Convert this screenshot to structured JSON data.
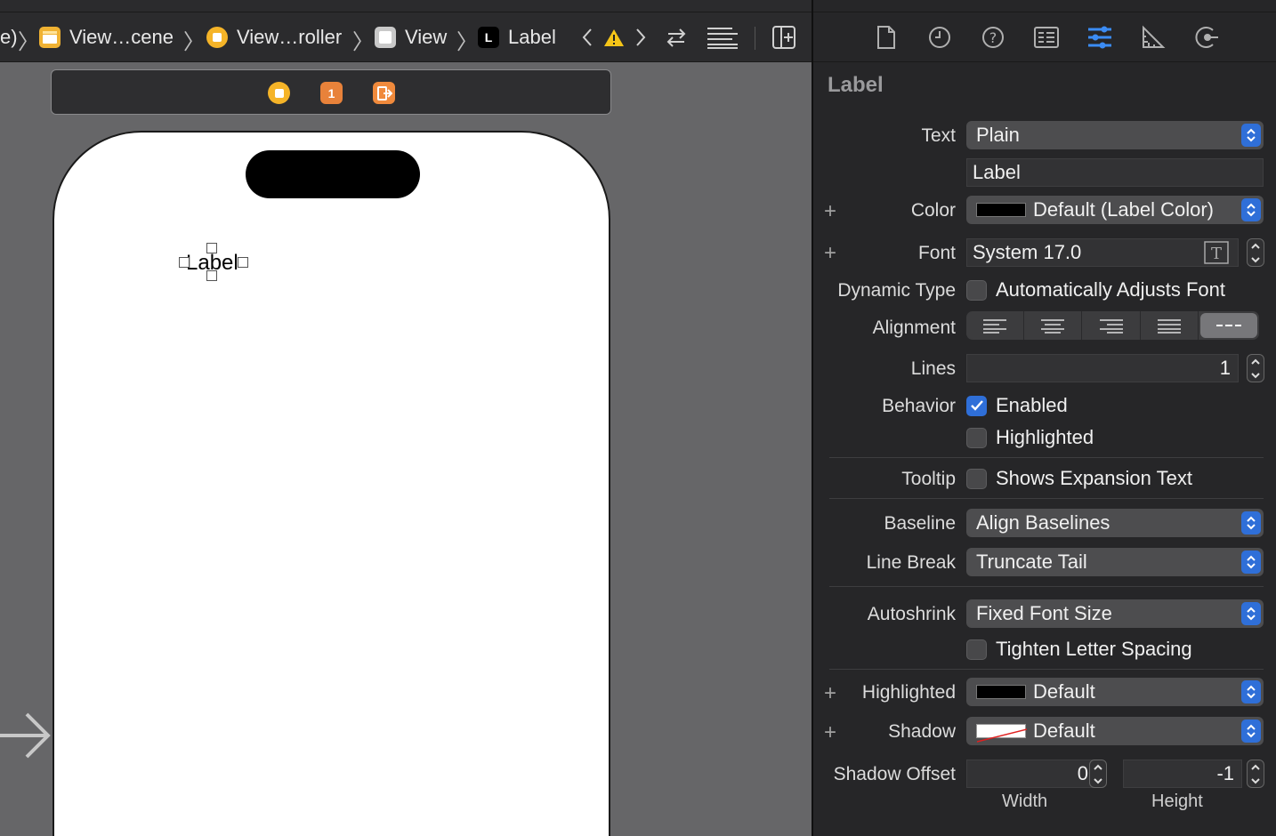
{
  "jumpbar": {
    "fragment": "e)",
    "crumbs": [
      {
        "label": "View…cene",
        "icon": "scene-icon"
      },
      {
        "label": "View…roller",
        "icon": "view-controller-icon"
      },
      {
        "label": "View",
        "icon": "view-icon"
      },
      {
        "label": "Label",
        "icon": "label-icon"
      }
    ],
    "label_icon_letter": "L"
  },
  "scene": {
    "dock_badge_count": "1",
    "canvas_label": "Label"
  },
  "inspector": {
    "tabs": [
      "file-inspector-icon",
      "history-inspector-icon",
      "quick-help-icon",
      "identity-inspector-icon",
      "attributes-inspector-icon",
      "size-inspector-icon",
      "connections-inspector-icon"
    ],
    "active_tab": "attributes-inspector-icon",
    "section_title": "Label",
    "text": {
      "label": "Text",
      "value": "Plain",
      "content": "Label"
    },
    "color": {
      "label": "Color",
      "value": "Default (Label Color)"
    },
    "font": {
      "label": "Font",
      "value": "System 17.0"
    },
    "dynamic_type": {
      "label": "Dynamic Type",
      "option": "Automatically Adjusts Font",
      "checked": false
    },
    "alignment": {
      "label": "Alignment",
      "selected": "natural"
    },
    "lines": {
      "label": "Lines",
      "value": "1"
    },
    "behavior": {
      "label": "Behavior",
      "enabled": "Enabled",
      "highlighted": "Highlighted"
    },
    "tooltip": {
      "label": "Tooltip",
      "option": "Shows Expansion Text"
    },
    "baseline": {
      "label": "Baseline",
      "value": "Align Baselines"
    },
    "line_break": {
      "label": "Line Break",
      "value": "Truncate Tail"
    },
    "autoshrink": {
      "label": "Autoshrink",
      "value": "Fixed Font Size",
      "option": "Tighten Letter Spacing"
    },
    "highlighted": {
      "label": "Highlighted",
      "value": "Default"
    },
    "shadow": {
      "label": "Shadow",
      "value": "Default"
    },
    "shadow_offset": {
      "label": "Shadow Offset",
      "width": "0",
      "height": "-1",
      "width_caption": "Width",
      "height_caption": "Height"
    }
  },
  "colors": {
    "accent": "#2f6fd8",
    "canvas": "#666668",
    "panel": "#262628"
  }
}
